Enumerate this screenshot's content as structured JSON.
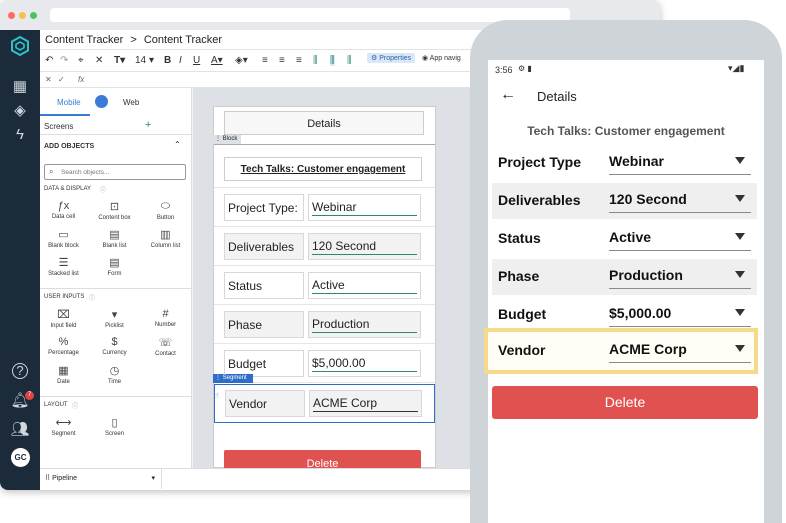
{
  "app": {
    "breadcrumb_root": "Content Tracker",
    "breadcrumb_sep": ">",
    "breadcrumb_current": "Content Tracker",
    "avatar": "GC",
    "notif_count": "7"
  },
  "toolbar": {
    "font_size": "14",
    "properties": "Properties",
    "app_nav": "App navig"
  },
  "formula": {
    "fx": "fx"
  },
  "left_panel": {
    "tab_mobile": "Mobile",
    "tab_web": "Web",
    "screens": "Screens",
    "add": "+",
    "add_objects": "ADD OBJECTS",
    "search_placeholder": "Search objects...",
    "data_display": "DATA & DISPLAY",
    "data_items": [
      "Data cell",
      "Content box",
      "Button",
      "Blank block",
      "Blank list",
      "Column list",
      "Stacked list",
      "Form"
    ],
    "user_inputs": "USER INPUTS",
    "input_items": [
      "Input field",
      "Picklist",
      "Number",
      "Percentage",
      "Currency",
      "Contact",
      "Date",
      "Time"
    ],
    "layout": "LAYOUT",
    "layout_items": [
      "Segment",
      "Screen"
    ],
    "pipeline": "Pipeline"
  },
  "editor": {
    "header": "Details",
    "block_tag": "Block",
    "segment_tag": "Segment",
    "title": "Tech Talks: Customer engagement",
    "rows": [
      {
        "label": "Project Type:",
        "value": "Webinar"
      },
      {
        "label": "Deliverables",
        "value": "120 Second"
      },
      {
        "label": "Status",
        "value": "Active"
      },
      {
        "label": "Phase",
        "value": "Production"
      },
      {
        "label": "Budget",
        "value": "$5,000.00"
      },
      {
        "label": "Vendor",
        "value": "ACME Corp"
      }
    ],
    "delete": "Delete"
  },
  "mobile": {
    "time": "3:56",
    "header": "Details",
    "title": "Tech Talks: Customer engagement",
    "rows": [
      {
        "label": "Project Type",
        "value": "Webinar"
      },
      {
        "label": "Deliverables",
        "value": "120 Second"
      },
      {
        "label": "Status",
        "value": "Active"
      },
      {
        "label": "Phase",
        "value": "Production"
      },
      {
        "label": "Budget",
        "value": "$5,000.00"
      },
      {
        "label": "Vendor",
        "value": "ACME Corp"
      }
    ],
    "delete": "Delete"
  },
  "colors": {
    "accent": "#3a7bd5",
    "delete": "#e05250",
    "highlight": "#f7d98a",
    "nav": "#1b2b3a"
  }
}
